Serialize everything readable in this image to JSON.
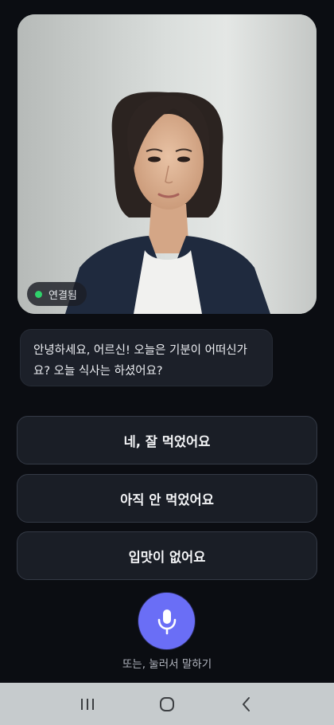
{
  "video": {
    "status_label": "연결됨",
    "status_color": "#2fd26b"
  },
  "chat": {
    "message": "안녕하세요, 어르신! 오늘은 기분이 어떠신가요? 오늘 식사는 하셨어요?"
  },
  "replies": [
    {
      "label": "네, 잘 먹었어요"
    },
    {
      "label": "아직 안 먹었어요"
    },
    {
      "label": "입맛이 없어요"
    }
  ],
  "voice": {
    "mic_icon": "microphone-icon",
    "hint": "또는, 눌러서 말하기",
    "accent_color": "#6a6ef6"
  },
  "navigation": {
    "buttons": [
      "recent-apps-icon",
      "home-icon",
      "back-icon"
    ]
  }
}
